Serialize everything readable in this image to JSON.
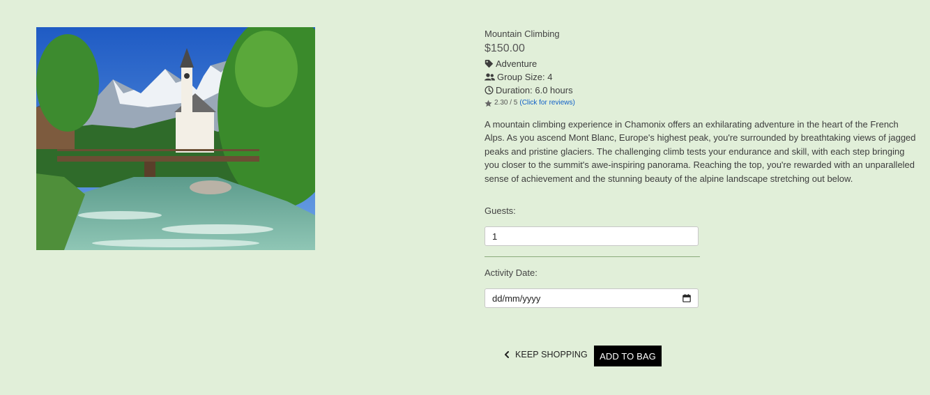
{
  "product": {
    "name": "Mountain Climbing",
    "price": "$150.00",
    "category": "Adventure",
    "group_size": "Group Size: 4",
    "duration": "Duration: 6.0 hours",
    "rating_text": "2.30 / 5",
    "rating_link": "(Click for reviews)",
    "description": "A mountain climbing experience in Chamonix offers an exhilarating adventure in the heart of the French Alps. As you ascend Mont Blanc, Europe's highest peak, you're surrounded by breathtaking views of jagged peaks and pristine glaciers. The challenging climb tests your endurance and skill, with each step bringing you closer to the summit's awe-inspiring panorama. Reaching the top, you're rewarded with an unparalleled sense of achievement and the stunning beauty of the alpine landscape stretching out below."
  },
  "form": {
    "guests_label": "Guests:",
    "guests_value": "1",
    "date_label": "Activity Date:",
    "date_placeholder": "dd/mm/yyyy"
  },
  "actions": {
    "keep_shopping": "KEEP SHOPPING",
    "add_to_bag": "ADD TO BAG"
  },
  "icons": {
    "category": "tag-icon",
    "group": "users-icon",
    "duration": "clock-icon",
    "rating": "star-icon",
    "date": "calendar-icon",
    "back": "chevron-left-icon"
  },
  "colors": {
    "background": "#e1efd9",
    "link": "#0f5fc7",
    "button": "#000000"
  }
}
